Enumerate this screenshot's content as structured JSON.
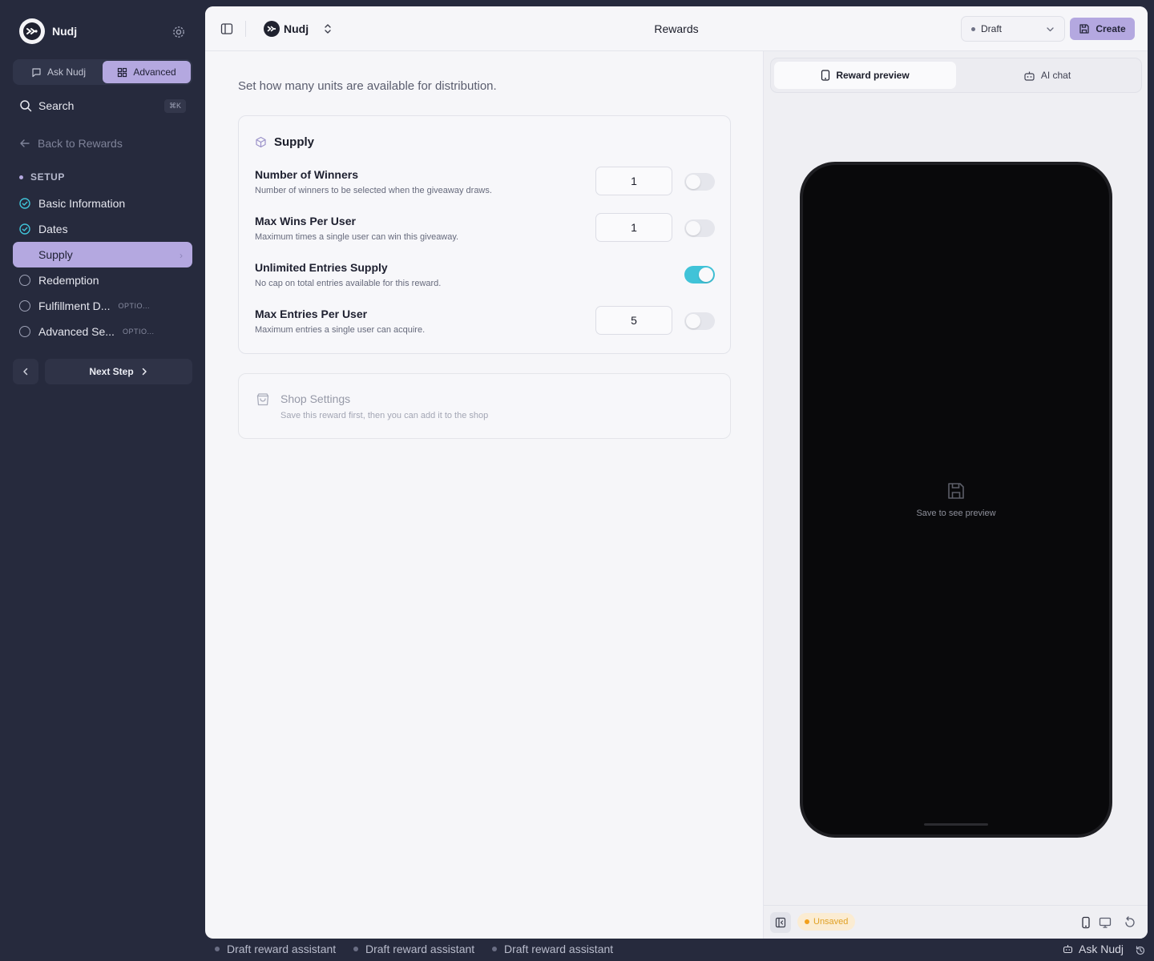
{
  "sidebar": {
    "brand_name": "Nudj",
    "mode_tabs": [
      {
        "label": "Ask Nudj",
        "icon": "chat-icon",
        "active": false
      },
      {
        "label": "Advanced",
        "icon": "grid-icon",
        "active": true
      }
    ],
    "search": {
      "label": "Search",
      "shortcut": "⌘K"
    },
    "back_link": "Back to Rewards",
    "section_label": "SETUP",
    "steps": [
      {
        "label": "Basic Information",
        "state": "complete"
      },
      {
        "label": "Dates",
        "state": "complete"
      },
      {
        "label": "Supply",
        "state": "active"
      },
      {
        "label": "Redemption",
        "state": "pending"
      },
      {
        "label": "Fulfillment D...",
        "state": "pending",
        "tag": "OPTIO..."
      },
      {
        "label": "Advanced Se...",
        "state": "pending",
        "tag": "OPTIO..."
      }
    ],
    "next_step_label": "Next Step"
  },
  "topbar": {
    "workspace_name": "Nudj",
    "page_title": "Rewards",
    "status_value": "Draft",
    "create_label": "Create"
  },
  "form": {
    "intro": "Set how many units are available for distribution.",
    "supply_card": {
      "title": "Supply",
      "rows": [
        {
          "title": "Number of Winners",
          "description": "Number of winners to be selected when the giveaway draws.",
          "value": "1",
          "toggle_on": false
        },
        {
          "title": "Max Wins Per User",
          "description": "Maximum times a single user can win this giveaway.",
          "value": "1",
          "toggle_on": false
        },
        {
          "title": "Unlimited Entries Supply",
          "description": "No cap on total entries available for this reward.",
          "value": null,
          "toggle_on": true
        },
        {
          "title": "Max Entries Per User",
          "description": "Maximum entries a single user can acquire.",
          "value": "5",
          "toggle_on": false
        }
      ]
    },
    "shop_card": {
      "title": "Shop Settings",
      "description": "Save this reward first, then you can add it to the shop"
    }
  },
  "preview": {
    "tabs": [
      {
        "label": "Reward preview",
        "icon": "phone-icon",
        "active": true
      },
      {
        "label": "AI chat",
        "icon": "bot-icon",
        "active": false
      }
    ],
    "placeholder": "Save to see preview",
    "unsaved_badge": "Unsaved"
  },
  "bottombar": {
    "items": [
      "Draft reward assistant",
      "Draft reward assistant",
      "Draft reward assistant"
    ],
    "ask_label": "Ask Nudj"
  },
  "colors": {
    "sidebar_bg": "#262a3d",
    "accent": "#b4a8e0",
    "toggle_on": "#40c3d8",
    "check": "#40c3d8",
    "unsaved": "#f2a01b"
  }
}
